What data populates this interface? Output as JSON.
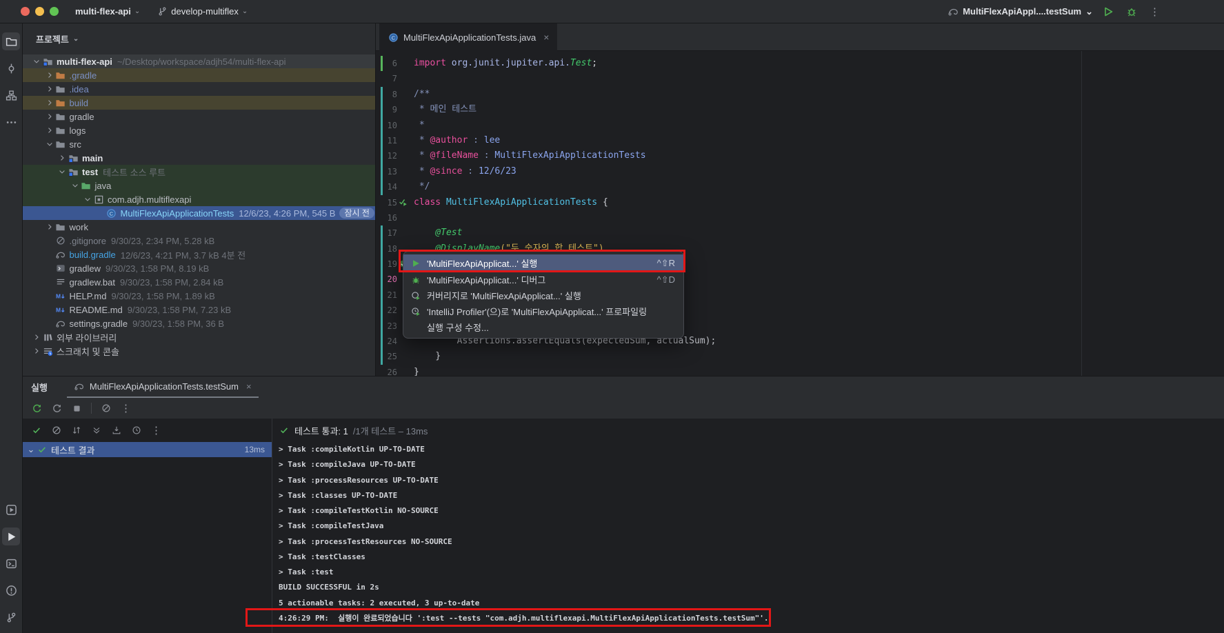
{
  "title_bar": {
    "project": "multi-flex-api",
    "branch": "develop-multiflex",
    "run_config": "MultiFlexApiAppl....testSum",
    "window_buttons": [
      "close",
      "minimize",
      "zoom"
    ],
    "right_icons": [
      "gradle-icon",
      "chevron-down-icon",
      "run-button",
      "debug-button",
      "more-vertical-icon"
    ]
  },
  "left_strip": {
    "top_icons": [
      "project-folder-icon",
      "commit-icon",
      "structure-icon",
      "more-horizontal-icon"
    ],
    "bottom_icons": [
      "services-icon",
      "run-strip-icon",
      "terminal-icon",
      "problems-icon",
      "git-branch-icon"
    ]
  },
  "project_panel": {
    "header": "프로젝트",
    "tree": [
      {
        "indent": 0,
        "chevron": "down",
        "icon": "module-icon",
        "label": "multi-flex-api",
        "style": "b",
        "annotation": "~/Desktop/workspace/adjh54/multi-flex-api",
        "row": "current"
      },
      {
        "indent": 1,
        "chevron": "right",
        "icon": "folder-orange-icon",
        "label": ".gradle",
        "style": "dir",
        "row": "excluded"
      },
      {
        "indent": 1,
        "chevron": "right",
        "icon": "folder-icon",
        "label": ".idea",
        "style": "dir"
      },
      {
        "indent": 1,
        "chevron": "right",
        "icon": "folder-orange-icon",
        "label": "build",
        "style": "dir",
        "row": "excluded"
      },
      {
        "indent": 1,
        "chevron": "right",
        "icon": "folder-icon",
        "label": "gradle"
      },
      {
        "indent": 1,
        "chevron": "right",
        "icon": "folder-icon",
        "label": "logs"
      },
      {
        "indent": 1,
        "chevron": "down",
        "icon": "folder-icon",
        "label": "src"
      },
      {
        "indent": 2,
        "chevron": "right",
        "icon": "module-icon",
        "label": "main",
        "style": "b"
      },
      {
        "indent": 2,
        "chevron": "down",
        "icon": "module-icon",
        "label": "test",
        "style": "b",
        "annotation": "테스트 소스 루트",
        "row": "test"
      },
      {
        "indent": 3,
        "chevron": "down",
        "icon": "folder-green-icon",
        "label": "java",
        "row": "test"
      },
      {
        "indent": 4,
        "chevron": "down",
        "icon": "package-icon",
        "label": "com.adjh.multiflexapi",
        "row": "test"
      },
      {
        "indent": 5,
        "chevron": null,
        "icon": "class-icon",
        "label": "MultiFlexApiApplicationTests",
        "style": "cls",
        "annotation": "12/6/23, 4:26 PM, 545 B",
        "badge": "잠시 전",
        "row": "selected"
      },
      {
        "indent": 1,
        "chevron": "right",
        "icon": "folder-icon",
        "label": "work"
      },
      {
        "indent": 1,
        "chevron": null,
        "icon": "ignored-icon",
        "label": ".gitignore",
        "style": "dim",
        "annotation": "9/30/23, 2:34 PM, 5.28 kB"
      },
      {
        "indent": 1,
        "chevron": null,
        "icon": "gradle-icon",
        "label": "build.gradle",
        "style": "link",
        "annotation": "12/6/23, 4:21 PM, 3.7 kB 4분 전"
      },
      {
        "indent": 1,
        "chevron": null,
        "icon": "gradlew-icon",
        "label": "gradlew",
        "annotation": "9/30/23, 1:58 PM, 8.19 kB"
      },
      {
        "indent": 1,
        "chevron": null,
        "icon": "batch-icon",
        "label": "gradlew.bat",
        "annotation": "9/30/23, 1:58 PM, 2.84 kB"
      },
      {
        "indent": 1,
        "chevron": null,
        "icon": "markdown-icon",
        "label": "HELP.md",
        "annotation": "9/30/23, 1:58 PM, 1.89 kB"
      },
      {
        "indent": 1,
        "chevron": null,
        "icon": "markdown-icon",
        "label": "README.md",
        "annotation": "9/30/23, 1:58 PM, 7.23 kB"
      },
      {
        "indent": 1,
        "chevron": null,
        "icon": "gradle-icon",
        "label": "settings.gradle",
        "annotation": "9/30/23, 1:58 PM, 36 B"
      },
      {
        "indent": 0,
        "chevron": "right",
        "icon": "library-icon",
        "label": "외부 라이브러리"
      },
      {
        "indent": 0,
        "chevron": "right",
        "icon": "scratch-icon",
        "label": "스크래치 및 콘솔"
      }
    ]
  },
  "editor": {
    "tab_label": "MultiFlexApiApplicationTests.java",
    "lines": [
      {
        "n": 6,
        "bar": "g",
        "tokens": [
          [
            "kw",
            "import"
          ],
          [
            "pl",
            " "
          ],
          [
            "pkg",
            "org.junit.jupiter.api."
          ],
          [
            "tg",
            "Test"
          ],
          [
            "pl",
            ";"
          ]
        ]
      },
      {
        "n": 7,
        "tokens": []
      },
      {
        "n": 8,
        "bar": "t",
        "tokens": [
          [
            "doc",
            "/**"
          ]
        ]
      },
      {
        "n": 9,
        "bar": "t",
        "tokens": [
          [
            "doc",
            " * 메인 테스트"
          ]
        ]
      },
      {
        "n": 10,
        "bar": "t",
        "tokens": [
          [
            "doc",
            " *"
          ]
        ]
      },
      {
        "n": 11,
        "bar": "t",
        "tokens": [
          [
            "doc",
            " * "
          ],
          [
            "dtag",
            "@author"
          ],
          [
            "doc",
            " : "
          ],
          [
            "dval",
            "lee"
          ]
        ]
      },
      {
        "n": 12,
        "bar": "t",
        "tokens": [
          [
            "doc",
            " * "
          ],
          [
            "dtag",
            "@fileName"
          ],
          [
            "doc",
            " : "
          ],
          [
            "dval",
            "MultiFlexApiApplicationTests"
          ]
        ]
      },
      {
        "n": 13,
        "bar": "t",
        "tokens": [
          [
            "doc",
            " * "
          ],
          [
            "dtag",
            "@since"
          ],
          [
            "doc",
            " : "
          ],
          [
            "dval",
            "12/6/23"
          ]
        ]
      },
      {
        "n": 14,
        "bar": "t",
        "tokens": [
          [
            "doc",
            " */"
          ]
        ]
      },
      {
        "n": 15,
        "run": "run-check-gutter-icon",
        "tokens": [
          [
            "kw",
            "class"
          ],
          [
            "pl",
            " "
          ],
          [
            "cls2",
            "MultiFlexApiApplicationTests"
          ],
          [
            "pl",
            " {"
          ]
        ]
      },
      {
        "n": 16,
        "tokens": []
      },
      {
        "n": 17,
        "bar": "t",
        "tokens": [
          [
            "pl",
            "    "
          ],
          [
            "an",
            "@Test"
          ]
        ]
      },
      {
        "n": 18,
        "bar": "t",
        "tokens": [
          [
            "pl",
            "    "
          ],
          [
            "an",
            "@DisplayName"
          ],
          [
            "yp",
            "("
          ],
          [
            "str",
            "\"두 숫자의 합 테스트\""
          ],
          [
            "yp",
            ")"
          ]
        ]
      },
      {
        "n": 19,
        "bar": "t",
        "run": "check-gutter-icon",
        "tokens": []
      },
      {
        "n": 20,
        "bar": "t",
        "current": true,
        "tokens": []
      },
      {
        "n": 21,
        "bar": "t",
        "tokens": []
      },
      {
        "n": 22,
        "bar": "t",
        "tokens": []
      },
      {
        "n": 23,
        "bar": "t",
        "tokens": []
      },
      {
        "n": 24,
        "bar": "t",
        "tokens": [
          [
            "pl",
            "        "
          ],
          [
            "pl2",
            "Assertions.assertEquals(expectedSum, actualSum);"
          ]
        ]
      },
      {
        "n": 25,
        "bar": "t",
        "tokens": [
          [
            "pl",
            "    "
          ],
          [
            "pl",
            "}"
          ]
        ]
      },
      {
        "n": 26,
        "tokens": [
          [
            "pl",
            "}"
          ]
        ]
      }
    ]
  },
  "context_menu": {
    "items": [
      {
        "icon": "run-play-icon",
        "label": "'MultiFlexApiApplicat...' 실행",
        "shortcut": "^⇧R",
        "selected": true,
        "boxed": true
      },
      {
        "icon": "debug-bug-icon",
        "label": "'MultiFlexApiApplicat...' 디버그",
        "shortcut": "^⇧D"
      },
      {
        "icon": "coverage-icon",
        "label": "커버리지로 'MultiFlexApiApplicat...' 실행",
        "shortcut": ""
      },
      {
        "icon": "profiler-icon",
        "label": "'IntelliJ Profiler'(으)로  'MultiFlexApiApplicat...' 프로파일링",
        "shortcut": ""
      },
      {
        "icon": null,
        "label": "실행 구성 수정...",
        "shortcut": ""
      }
    ]
  },
  "run_panel": {
    "window_label": "실행",
    "tab_label": "MultiFlexApiApplicationTests.testSum",
    "tab_icon": "gradle-icon",
    "toolbar1": [
      "rerun-icon",
      "rerun-failed-icon",
      "stop-icon",
      "divider",
      "no-entry-icon",
      "more-vertical-icon"
    ],
    "toolbar2": [
      "check-icon",
      "no-entry-icon",
      "sort-icon",
      "expand-icon",
      "import-icon",
      "history-icon",
      "more-vertical-icon"
    ],
    "status": {
      "icon": "check-icon",
      "strong": "테스트 통과: 1",
      "dim": " /1개 테스트 – 13ms"
    },
    "tree_row": {
      "chevron": "down",
      "icon": "check-icon",
      "label": "테스트 결과",
      "time": "13ms"
    },
    "console": [
      {
        "text": "> Task :compileKotlin UP-TO-DATE"
      },
      {
        "text": "> Task :compileJava UP-TO-DATE"
      },
      {
        "text": "> Task :processResources UP-TO-DATE"
      },
      {
        "text": "> Task :classes UP-TO-DATE"
      },
      {
        "text": "> Task :compileTestKotlin NO-SOURCE"
      },
      {
        "text": "> Task :compileTestJava"
      },
      {
        "text": "> Task :processTestResources NO-SOURCE"
      },
      {
        "text": "> Task :testClasses"
      },
      {
        "text": "> Task :test"
      },
      {
        "text": "BUILD SUCCESSFUL in 2s"
      },
      {
        "text": "5 actionable tasks: 2 executed, 3 up-to-date"
      },
      {
        "text": "4:26:29 PM:  실행이 완료되었습니다 ':test --tests \"com.adjh.multiflexapi.MultiFlexApiApplicationTests.testSum\"'.",
        "boxed": true
      }
    ]
  },
  "colors": {
    "accent_blue": "#3b5792",
    "test_green_row": "#2c3b2d",
    "excluded_olive_row": "#474430",
    "annotation_red": "#e21717",
    "run_green": "#4fae50"
  }
}
